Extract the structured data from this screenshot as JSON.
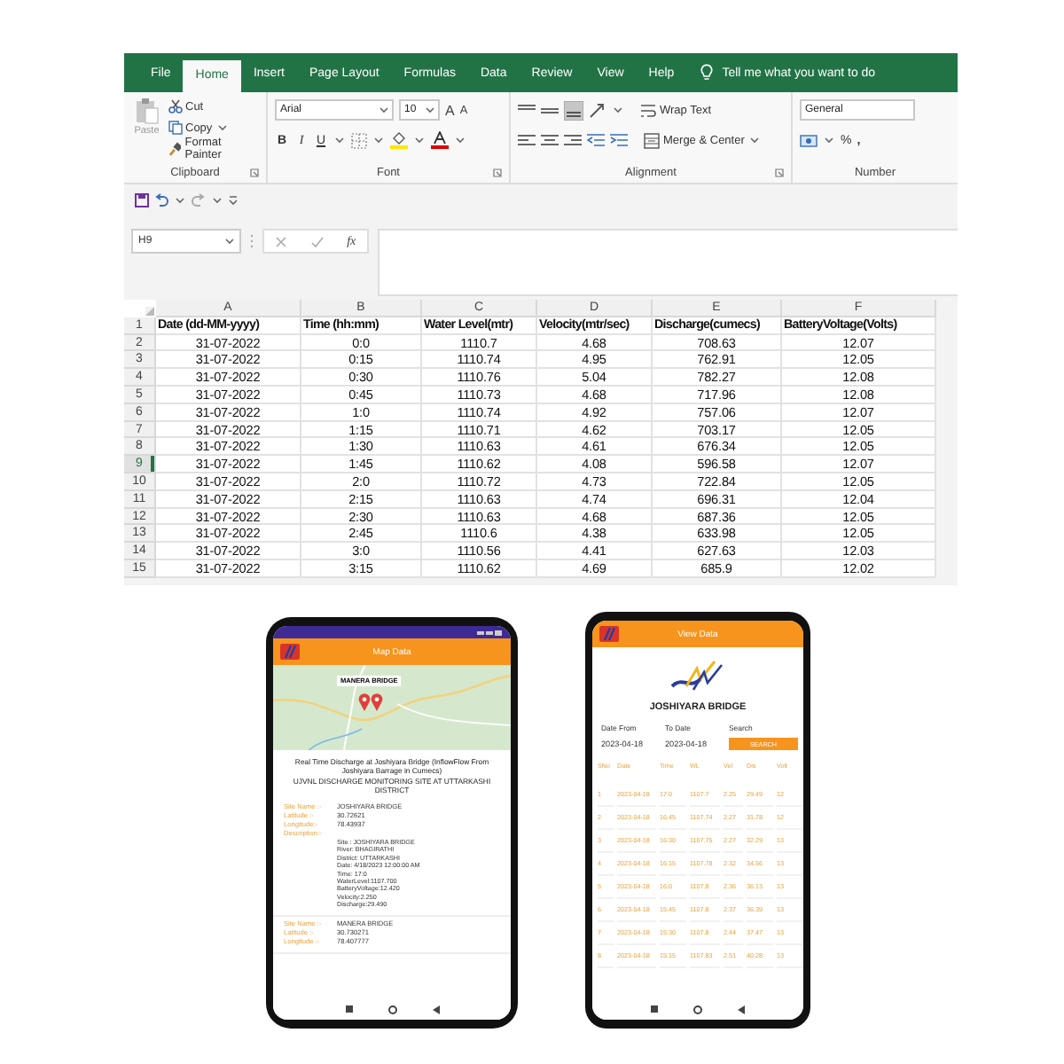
{
  "excel": {
    "tabs": [
      {
        "label": "File",
        "selected": false
      },
      {
        "label": "Home",
        "selected": true
      },
      {
        "label": "Insert",
        "selected": false
      },
      {
        "label": "Page Layout",
        "selected": false
      },
      {
        "label": "Formulas",
        "selected": false
      },
      {
        "label": "Data",
        "selected": false
      },
      {
        "label": "Review",
        "selected": false
      },
      {
        "label": "View",
        "selected": false
      },
      {
        "label": "Help",
        "selected": false
      }
    ],
    "tell_me": "Tell me what you want to do",
    "clipboard": {
      "paste": "Paste",
      "cut": "Cut",
      "copy": "Copy",
      "format_painter": "Format Painter",
      "label": "Clipboard"
    },
    "font": {
      "name": "Arial",
      "size": "10",
      "grow": "A",
      "shrink": "A",
      "bold": "B",
      "italic": "I",
      "underline": "U",
      "label": "Font"
    },
    "alignment": {
      "wrap_text": "Wrap Text",
      "merge": "Merge & Center",
      "label": "Alignment"
    },
    "number": {
      "format": "General",
      "percent": "%",
      "comma": ",",
      "label": "Number"
    },
    "name_box": "H9",
    "fx": "fx",
    "columns": [
      "A",
      "B",
      "C",
      "D",
      "E",
      "F"
    ],
    "rows": [
      {
        "number": "1",
        "selected": false,
        "header": true,
        "cells": [
          "Date (dd-MM-yyyy)",
          "Time (hh:mm)",
          "Water Level(mtr)",
          "Velocity(mtr/sec)",
          "Discharge(cumecs)",
          "BatteryVoltage(Volts)"
        ]
      },
      {
        "number": "2",
        "selected": false,
        "header": false,
        "cells": [
          "31-07-2022",
          "0:0",
          "1110.7",
          "4.68",
          "708.63",
          "12.07"
        ]
      },
      {
        "number": "3",
        "selected": false,
        "header": false,
        "cells": [
          "31-07-2022",
          "0:15",
          "1110.74",
          "4.95",
          "762.91",
          "12.05"
        ]
      },
      {
        "number": "4",
        "selected": false,
        "header": false,
        "cells": [
          "31-07-2022",
          "0:30",
          "1110.76",
          "5.04",
          "782.27",
          "12.08"
        ]
      },
      {
        "number": "5",
        "selected": false,
        "header": false,
        "cells": [
          "31-07-2022",
          "0:45",
          "1110.73",
          "4.68",
          "717.96",
          "12.08"
        ]
      },
      {
        "number": "6",
        "selected": false,
        "header": false,
        "cells": [
          "31-07-2022",
          "1:0",
          "1110.74",
          "4.92",
          "757.06",
          "12.07"
        ]
      },
      {
        "number": "7",
        "selected": false,
        "header": false,
        "cells": [
          "31-07-2022",
          "1:15",
          "1110.71",
          "4.62",
          "703.17",
          "12.05"
        ]
      },
      {
        "number": "8",
        "selected": false,
        "header": false,
        "cells": [
          "31-07-2022",
          "1:30",
          "1110.63",
          "4.61",
          "676.34",
          "12.05"
        ]
      },
      {
        "number": "9",
        "selected": true,
        "header": false,
        "cells": [
          "31-07-2022",
          "1:45",
          "1110.62",
          "4.08",
          "596.58",
          "12.07"
        ]
      },
      {
        "number": "10",
        "selected": false,
        "header": false,
        "cells": [
          "31-07-2022",
          "2:0",
          "1110.72",
          "4.73",
          "722.84",
          "12.05"
        ]
      },
      {
        "number": "11",
        "selected": false,
        "header": false,
        "cells": [
          "31-07-2022",
          "2:15",
          "1110.63",
          "4.74",
          "696.31",
          "12.04"
        ]
      },
      {
        "number": "12",
        "selected": false,
        "header": false,
        "cells": [
          "31-07-2022",
          "2:30",
          "1110.63",
          "4.68",
          "687.36",
          "12.05"
        ]
      },
      {
        "number": "13",
        "selected": false,
        "header": false,
        "cells": [
          "31-07-2022",
          "2:45",
          "1110.6",
          "4.38",
          "633.98",
          "12.05"
        ]
      },
      {
        "number": "14",
        "selected": false,
        "header": false,
        "cells": [
          "31-07-2022",
          "3:0",
          "1110.56",
          "4.41",
          "627.63",
          "12.03"
        ]
      },
      {
        "number": "15",
        "selected": false,
        "header": false,
        "cells": [
          "31-07-2022",
          "3:15",
          "1110.62",
          "4.69",
          "685.9",
          "12.02"
        ]
      }
    ]
  },
  "map_phone": {
    "title": "Map Data",
    "map_label": "MANERA BRIDGE",
    "headline": "Real Time Discharge at Joshiyara Bridge (InflowFlow From Joshiyara Barrage in Cumecs)",
    "subhead": "UJVNL DISCHARGE MONITORING SITE AT UTTARKASHI DISTRICT",
    "sites": [
      {
        "fields": [
          {
            "label": "Site Name :-",
            "value": "JOSHIYARA BRIDGE"
          },
          {
            "label": "Latitude :-",
            "value": "30.72621"
          },
          {
            "label": "Longitude:-",
            "value": "78.43937"
          },
          {
            "label": "Description:-"
          }
        ],
        "description": [
          "Site : JOSHIYARA BRIDGE",
          "River: BHAGIRATHI",
          "District: UTTARKASHI",
          "Date: 4/18/2023 12:00:00 AM",
          "Time: 17:0",
          "WaterLevel:1107.700",
          "BatteryVoltage:12.420",
          "Velocity:2.250",
          "Discharge:29.490"
        ]
      },
      {
        "fields": [
          {
            "label": "Site Name :-",
            "value": "MANERA BRIDGE"
          },
          {
            "label": "Latitude :-",
            "value": "30.730271"
          },
          {
            "label": "Longitude :-",
            "value": "78.407777"
          }
        ]
      }
    ]
  },
  "data_phone": {
    "title": "View Data",
    "site": "JOSHIYARA BRIDGE",
    "from_label": "Date From",
    "to_label": "To Date",
    "search_label": "Search",
    "from": "2023-04-18",
    "to": "2023-04-18",
    "search_button": "SEARCH",
    "columns": [
      "SNo",
      "Date",
      "Time",
      "WL",
      "Vel",
      "Dis",
      "Volt"
    ],
    "rows": [
      [
        "1",
        "2023-04-18",
        "17:0",
        "1107.7",
        "2.25",
        "29.49",
        "12"
      ],
      [
        "2",
        "2023-04-18",
        "16:45",
        "1107.74",
        "2.27",
        "31.78",
        "12"
      ],
      [
        "3",
        "2023-04-18",
        "16:30",
        "1107.75",
        "2.27",
        "32.29",
        "13"
      ],
      [
        "4",
        "2023-04-18",
        "16:15",
        "1107.78",
        "2.32",
        "34.56",
        "13"
      ],
      [
        "5",
        "2023-04-18",
        "16:0",
        "1107.8",
        "2.36",
        "36.13",
        "13"
      ],
      [
        "6",
        "2023-04-18",
        "15:45",
        "1107.8",
        "2.37",
        "36.39",
        "13"
      ],
      [
        "7",
        "2023-04-18",
        "15:30",
        "1107.8",
        "2.44",
        "37.47",
        "13"
      ],
      [
        "8",
        "2023-04-18",
        "15:15",
        "1107.83",
        "2.51",
        "40.28",
        "13"
      ]
    ]
  }
}
